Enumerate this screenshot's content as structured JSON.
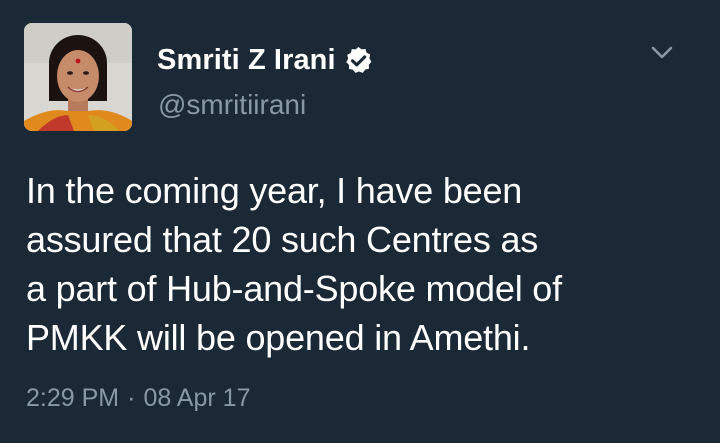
{
  "tweet": {
    "author": {
      "display_name": "Smriti Z Irani",
      "handle": "@smritiirani",
      "verified": true
    },
    "text": "In the coming year, I have been\nassured that 20 such Centres as\na part of Hub-and-Spoke model of\nPMKK will be opened in Amethi.",
    "time": "2:29 PM",
    "separator": "·",
    "date": "08 Apr 17"
  },
  "icons": {
    "verified": "verified-badge-icon",
    "menu": "chevron-down-icon"
  },
  "colors": {
    "background": "#1b2836",
    "primary_text": "#ffffff",
    "secondary_text": "#8899a6"
  }
}
